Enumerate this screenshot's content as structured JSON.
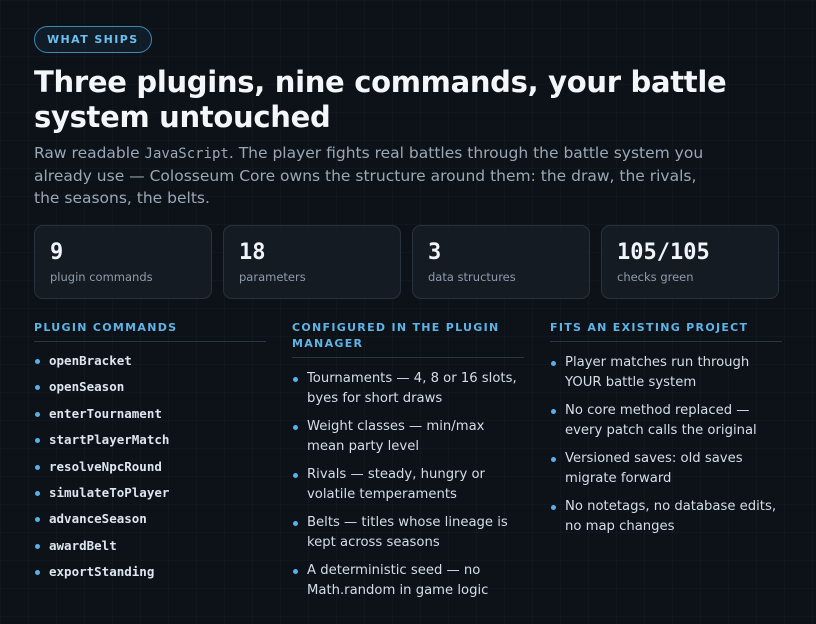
{
  "eyebrow": "WHAT SHIPS",
  "title": "Three plugins, nine commands, your battle system untouched",
  "lede": {
    "part1": "Raw readable ",
    "mono": "JavaScript",
    "part2": ". The player fights real battles through the battle system you already use — Colosseum Core owns the structure around them: the draw, the rivals, the seasons, the belts."
  },
  "stats": [
    {
      "value": "9",
      "label": "plugin commands"
    },
    {
      "value": "18",
      "label": "parameters"
    },
    {
      "value": "3",
      "label": "data structures"
    },
    {
      "value": "105/105",
      "label": "checks green"
    }
  ],
  "columns": {
    "commands": {
      "heading": "PLUGIN COMMANDS",
      "items": [
        "openBracket",
        "openSeason",
        "enterTournament",
        "startPlayerMatch",
        "resolveNpcRound",
        "simulateToPlayer",
        "advanceSeason",
        "awardBelt",
        "exportStanding"
      ]
    },
    "config": {
      "heading": "CONFIGURED IN THE PLUGIN MANAGER",
      "items": [
        "Tournaments — 4, 8 or 16 slots, byes for short draws",
        "Weight classes — min/max mean party level",
        "Rivals — steady, hungry or volatile temperaments",
        "Belts — titles whose lineage is kept across seasons",
        "A deterministic seed — no Math.random in game logic"
      ]
    },
    "fits": {
      "heading": "FITS AN EXISTING PROJECT",
      "items": [
        "Player matches run through YOUR battle system",
        "No core method replaced — every patch calls the original",
        "Versioned saves: old saves migrate forward",
        "No notetags, no database edits, no map changes"
      ]
    }
  },
  "colors": {
    "accent": "#5fb4e6",
    "background": "#0d1219",
    "card_border": "#273240"
  }
}
